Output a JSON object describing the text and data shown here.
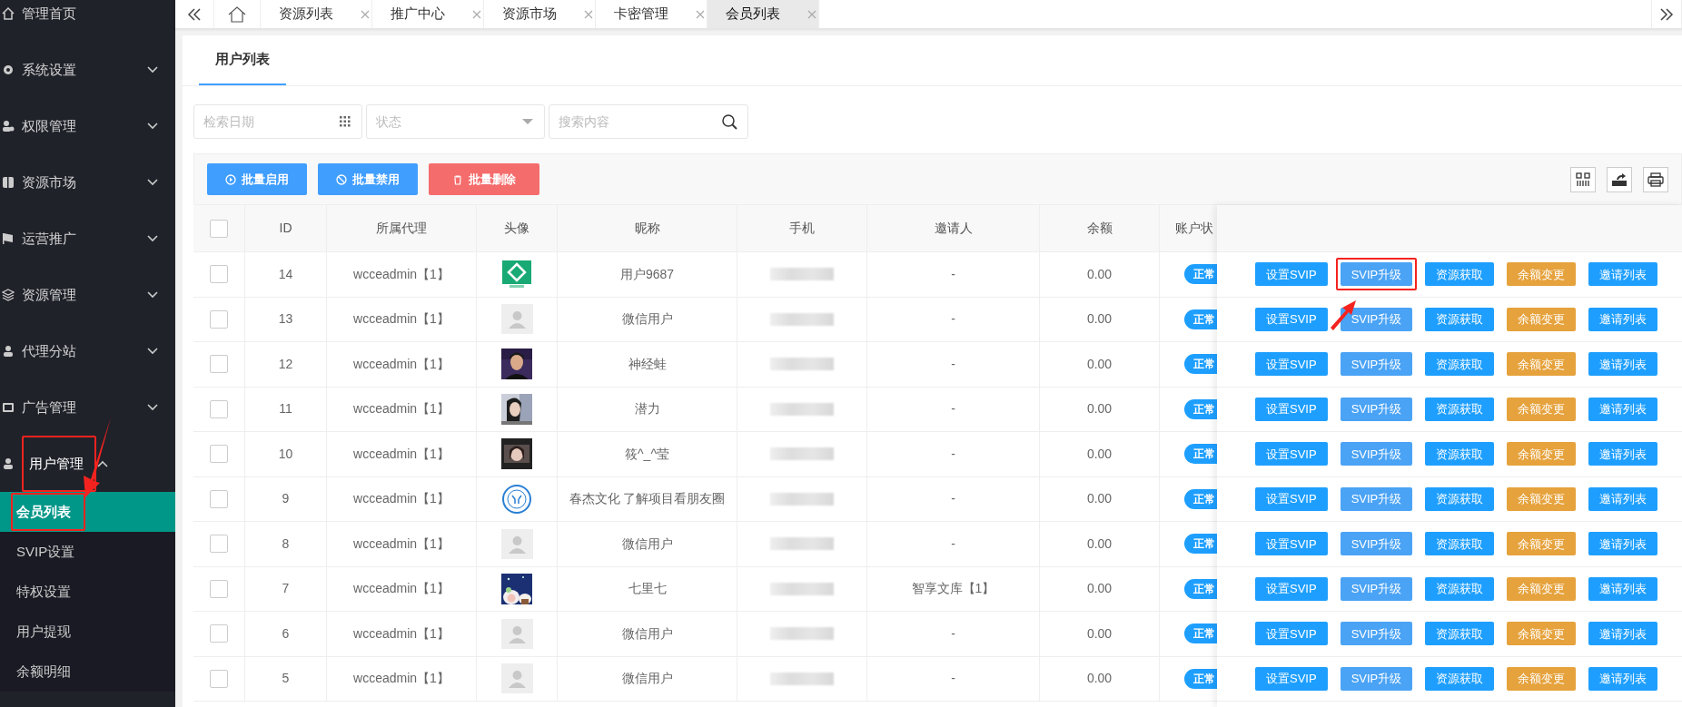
{
  "sidebar": {
    "items": [
      {
        "label": "管理首页",
        "kind": "link",
        "expanded": false,
        "highlighted": false
      },
      {
        "label": "系统设置",
        "kind": "menu",
        "expanded": false,
        "highlighted": false
      },
      {
        "label": "权限管理",
        "kind": "menu",
        "expanded": false,
        "highlighted": false
      },
      {
        "label": "资源市场",
        "kind": "menu",
        "expanded": false,
        "highlighted": false
      },
      {
        "label": "运营推广",
        "kind": "menu",
        "expanded": false,
        "highlighted": false
      },
      {
        "label": "资源管理",
        "kind": "menu",
        "expanded": false,
        "highlighted": false
      },
      {
        "label": "代理分站",
        "kind": "menu",
        "expanded": false,
        "highlighted": false
      },
      {
        "label": "广告管理",
        "kind": "menu",
        "expanded": false,
        "highlighted": false
      },
      {
        "label": "用户管理",
        "kind": "menu",
        "expanded": true,
        "highlighted": true,
        "children": [
          {
            "label": "会员列表",
            "selected": true,
            "highlighted": true
          },
          {
            "label": "SVIP设置",
            "selected": false,
            "highlighted": false
          },
          {
            "label": "特权设置",
            "selected": false,
            "highlighted": false
          },
          {
            "label": "用户提现",
            "selected": false,
            "highlighted": false
          },
          {
            "label": "余额明细",
            "selected": false,
            "highlighted": false
          }
        ]
      }
    ]
  },
  "page_tabs": [
    {
      "label": "资源列表",
      "selected": false
    },
    {
      "label": "推广中心",
      "selected": false
    },
    {
      "label": "资源市场",
      "selected": false
    },
    {
      "label": "卡密管理",
      "selected": false
    },
    {
      "label": "会员列表",
      "selected": true
    }
  ],
  "card": {
    "title": "用户列表"
  },
  "filters": {
    "date": {
      "placeholder": "检索日期"
    },
    "status": {
      "placeholder": "状态"
    },
    "search": {
      "placeholder": "搜索内容"
    }
  },
  "bulk_buttons": [
    {
      "label": "批量启用",
      "kind": "enable"
    },
    {
      "label": "批量禁用",
      "kind": "disable"
    },
    {
      "label": "批量删除",
      "kind": "delete"
    }
  ],
  "table": {
    "select_all": {
      "checked": false
    },
    "columns": [
      "ID",
      "所属代理",
      "头像",
      "昵称",
      "手机",
      "邀请人",
      "余额",
      "账户状"
    ],
    "rows": [
      {
        "checked": false,
        "id": "14",
        "agent": "wcceadmin【1】",
        "nickname": "用户9687",
        "inviter": "-",
        "balance": "0.00",
        "status": "正常",
        "actions": [
          {
            "label": "设置SVIP",
            "kind": "primary",
            "highlighted": false
          },
          {
            "label": "SVIP升级",
            "kind": "info",
            "highlighted": true
          },
          {
            "label": "资源获取",
            "kind": "primary",
            "highlighted": false
          },
          {
            "label": "余额变更",
            "kind": "warning",
            "highlighted": false
          },
          {
            "label": "邀请列表",
            "kind": "primary",
            "highlighted": false
          }
        ]
      },
      {
        "checked": false,
        "id": "13",
        "agent": "wcceadmin【1】",
        "avatar": {
          "kind": "default"
        },
        "nickname": "微信用户",
        "inviter": "-",
        "balance": "0.00",
        "status": "正常",
        "actions": [
          {
            "label": "设置SVIP",
            "kind": "primary",
            "highlighted": false
          },
          {
            "label": "SVIP升级",
            "kind": "info",
            "highlighted": false
          },
          {
            "label": "资源获取",
            "kind": "primary",
            "highlighted": false
          },
          {
            "label": "余额变更",
            "kind": "warning",
            "highlighted": false
          },
          {
            "label": "邀请列表",
            "kind": "primary",
            "highlighted": false
          }
        ]
      },
      {
        "checked": false,
        "id": "12",
        "agent": "wcceadmin【1】",
        "nickname": "神经蛙",
        "inviter": "-",
        "balance": "0.00",
        "status": "正常",
        "actions": [
          {
            "label": "设置SVIP",
            "kind": "primary",
            "highlighted": false
          },
          {
            "label": "SVIP升级",
            "kind": "info",
            "highlighted": false
          },
          {
            "label": "资源获取",
            "kind": "primary",
            "highlighted": false
          },
          {
            "label": "余额变更",
            "kind": "warning",
            "highlighted": false
          },
          {
            "label": "邀请列表",
            "kind": "primary",
            "highlighted": false
          }
        ]
      },
      {
        "checked": false,
        "id": "11",
        "agent": "wcceadmin【1】",
        "nickname": "潜力",
        "inviter": "-",
        "balance": "0.00",
        "status": "正常",
        "actions": [
          {
            "label": "设置SVIP",
            "kind": "primary",
            "highlighted": false
          },
          {
            "label": "SVIP升级",
            "kind": "info",
            "highlighted": false
          },
          {
            "label": "资源获取",
            "kind": "primary",
            "highlighted": false
          },
          {
            "label": "余额变更",
            "kind": "warning",
            "highlighted": false
          },
          {
            "label": "邀请列表",
            "kind": "primary",
            "highlighted": false
          }
        ]
      },
      {
        "checked": false,
        "id": "10",
        "agent": "wcceadmin【1】",
        "nickname": "筱^_^莹",
        "inviter": "-",
        "balance": "0.00",
        "status": "正常",
        "actions": [
          {
            "label": "设置SVIP",
            "kind": "primary",
            "highlighted": false
          },
          {
            "label": "SVIP升级",
            "kind": "info",
            "highlighted": false
          },
          {
            "label": "资源获取",
            "kind": "primary",
            "highlighted": false
          },
          {
            "label": "余额变更",
            "kind": "warning",
            "highlighted": false
          },
          {
            "label": "邀请列表",
            "kind": "primary",
            "highlighted": false
          }
        ]
      },
      {
        "checked": false,
        "id": "9",
        "agent": "wcceadmin【1】",
        "nickname": "春杰文化 了解项目看朋友圈",
        "inviter": "-",
        "balance": "0.00",
        "status": "正常",
        "actions": [
          {
            "label": "设置SVIP",
            "kind": "primary",
            "highlighted": false
          },
          {
            "label": "SVIP升级",
            "kind": "info",
            "highlighted": false
          },
          {
            "label": "资源获取",
            "kind": "primary",
            "highlighted": false
          },
          {
            "label": "余额变更",
            "kind": "warning",
            "highlighted": false
          },
          {
            "label": "邀请列表",
            "kind": "primary",
            "highlighted": false
          }
        ]
      },
      {
        "checked": false,
        "id": "8",
        "agent": "wcceadmin【1】",
        "avatar": {
          "kind": "default"
        },
        "nickname": "微信用户",
        "inviter": "-",
        "balance": "0.00",
        "status": "正常",
        "actions": [
          {
            "label": "设置SVIP",
            "kind": "primary",
            "highlighted": false
          },
          {
            "label": "SVIP升级",
            "kind": "info",
            "highlighted": false
          },
          {
            "label": "资源获取",
            "kind": "primary",
            "highlighted": false
          },
          {
            "label": "余额变更",
            "kind": "warning",
            "highlighted": false
          },
          {
            "label": "邀请列表",
            "kind": "primary",
            "highlighted": false
          }
        ]
      },
      {
        "checked": false,
        "id": "7",
        "agent": "wcceadmin【1】",
        "nickname": "七里七",
        "inviter": "智享文库【1】",
        "balance": "0.00",
        "status": "正常",
        "actions": [
          {
            "label": "设置SVIP",
            "kind": "primary",
            "highlighted": false
          },
          {
            "label": "SVIP升级",
            "kind": "info",
            "highlighted": false
          },
          {
            "label": "资源获取",
            "kind": "primary",
            "highlighted": false
          },
          {
            "label": "余额变更",
            "kind": "warning",
            "highlighted": false
          },
          {
            "label": "邀请列表",
            "kind": "primary",
            "highlighted": false
          }
        ]
      },
      {
        "checked": false,
        "id": "6",
        "agent": "wcceadmin【1】",
        "avatar": {
          "kind": "default"
        },
        "nickname": "微信用户",
        "inviter": "-",
        "balance": "0.00",
        "status": "正常",
        "actions": [
          {
            "label": "设置SVIP",
            "kind": "primary",
            "highlighted": false
          },
          {
            "label": "SVIP升级",
            "kind": "info",
            "highlighted": false
          },
          {
            "label": "资源获取",
            "kind": "primary",
            "highlighted": false
          },
          {
            "label": "余额变更",
            "kind": "warning",
            "highlighted": false
          },
          {
            "label": "邀请列表",
            "kind": "primary",
            "highlighted": false
          }
        ]
      },
      {
        "checked": false,
        "id": "5",
        "agent": "wcceadmin【1】",
        "avatar": {
          "kind": "default"
        },
        "nickname": "微信用户",
        "inviter": "-",
        "balance": "0.00",
        "status": "正常",
        "actions": [
          {
            "label": "设置SVIP",
            "kind": "primary",
            "highlighted": false
          },
          {
            "label": "SVIP升级",
            "kind": "info",
            "highlighted": false
          },
          {
            "label": "资源获取",
            "kind": "primary",
            "highlighted": false
          },
          {
            "label": "余额变更",
            "kind": "warning",
            "highlighted": false
          },
          {
            "label": "邀请列表",
            "kind": "primary",
            "highlighted": false
          }
        ]
      }
    ]
  }
}
